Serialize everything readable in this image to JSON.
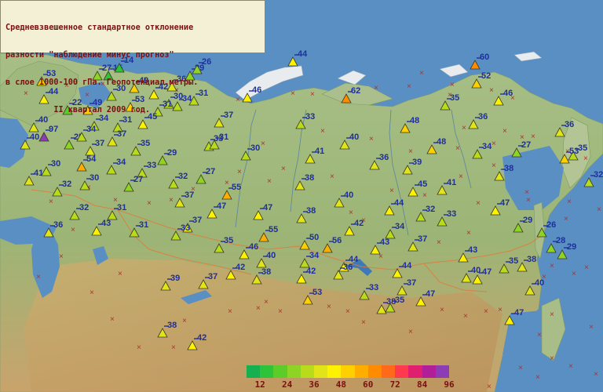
{
  "title": {
    "lines": [
      "Средневзвешенное стандартное отклонение",
      "разности \"наблюдение минус прогноз\"",
      "в слое 1000-100 гПа. Геопотенциал.метры.",
      "          II квартал 2009 год."
    ]
  },
  "legend": {
    "colors": [
      "#16b050",
      "#2ec43a",
      "#5ccc28",
      "#8ed424",
      "#b8dc1c",
      "#e0e418",
      "#fff200",
      "#ffd000",
      "#ffae00",
      "#ff8c00",
      "#ff6a1a",
      "#ff3a4e",
      "#e0206e",
      "#b01e9a",
      "#8c3cb4"
    ],
    "tick_labels": [
      "12",
      "24",
      "36",
      "48",
      "60",
      "72",
      "84",
      "96"
    ]
  },
  "stations": [
    {
      "value": "53"
    },
    {
      "value": "27"
    },
    {
      "value": "15"
    },
    {
      "value": "14"
    },
    {
      "value": "44"
    },
    {
      "value": "30"
    },
    {
      "value": "49"
    },
    {
      "value": "42"
    },
    {
      "value": "36"
    },
    {
      "value": "29"
    },
    {
      "value": "26"
    },
    {
      "value": "44"
    },
    {
      "value": "22"
    },
    {
      "value": "49"
    },
    {
      "value": "53"
    },
    {
      "value": "30"
    },
    {
      "value": "31"
    },
    {
      "value": "34"
    },
    {
      "value": "31"
    },
    {
      "value": "46"
    },
    {
      "value": "62"
    },
    {
      "value": "60"
    },
    {
      "value": "52"
    },
    {
      "value": "35"
    },
    {
      "value": "46"
    },
    {
      "value": "40"
    },
    {
      "value": "34"
    },
    {
      "value": "31"
    },
    {
      "value": "45"
    },
    {
      "value": "37"
    },
    {
      "value": "33"
    },
    {
      "value": "48"
    },
    {
      "value": "36"
    },
    {
      "value": "36"
    },
    {
      "value": "40"
    },
    {
      "value": "97"
    },
    {
      "value": "25"
    },
    {
      "value": "34"
    },
    {
      "value": "37"
    },
    {
      "value": "35"
    },
    {
      "value": "33"
    },
    {
      "value": "31"
    },
    {
      "value": "40"
    },
    {
      "value": "48"
    },
    {
      "value": "41"
    },
    {
      "value": "27"
    },
    {
      "value": "35"
    },
    {
      "value": "34"
    },
    {
      "value": "37"
    },
    {
      "value": "54"
    },
    {
      "value": "34"
    },
    {
      "value": "29"
    },
    {
      "value": "30"
    },
    {
      "value": "41"
    },
    {
      "value": "36"
    },
    {
      "value": "39"
    },
    {
      "value": "53"
    },
    {
      "value": "30"
    },
    {
      "value": "33"
    },
    {
      "value": "38"
    },
    {
      "value": "32"
    },
    {
      "value": "41"
    },
    {
      "value": "32"
    },
    {
      "value": "30"
    },
    {
      "value": "27"
    },
    {
      "value": "32"
    },
    {
      "value": "27"
    },
    {
      "value": "55"
    },
    {
      "value": "38"
    },
    {
      "value": "45"
    },
    {
      "value": "31"
    },
    {
      "value": "47"
    },
    {
      "value": "32"
    },
    {
      "value": "37"
    },
    {
      "value": "47"
    },
    {
      "value": "40"
    },
    {
      "value": "44"
    },
    {
      "value": "38"
    },
    {
      "value": "32"
    },
    {
      "value": "33"
    },
    {
      "value": "31"
    },
    {
      "value": "36"
    },
    {
      "value": "43"
    },
    {
      "value": "47"
    },
    {
      "value": "42"
    },
    {
      "value": "34"
    },
    {
      "value": "37"
    },
    {
      "value": "33"
    },
    {
      "value": "55"
    },
    {
      "value": "50"
    },
    {
      "value": "29"
    },
    {
      "value": "26"
    },
    {
      "value": "35"
    },
    {
      "value": "56"
    },
    {
      "value": "46"
    },
    {
      "value": "40"
    },
    {
      "value": "34"
    },
    {
      "value": "44"
    },
    {
      "value": "43"
    },
    {
      "value": "37"
    },
    {
      "value": "43"
    },
    {
      "value": "28"
    },
    {
      "value": "29"
    },
    {
      "value": "38"
    },
    {
      "value": "42"
    },
    {
      "value": "36"
    },
    {
      "value": "44"
    },
    {
      "value": "40"
    },
    {
      "value": "35"
    },
    {
      "value": "38"
    },
    {
      "value": "39"
    },
    {
      "value": "37"
    },
    {
      "value": "42"
    },
    {
      "value": "47"
    },
    {
      "value": "40"
    },
    {
      "value": "53"
    },
    {
      "value": "33"
    },
    {
      "value": "37"
    },
    {
      "value": "47"
    },
    {
      "value": "38"
    },
    {
      "value": "35"
    },
    {
      "value": "38"
    },
    {
      "value": "42"
    },
    {
      "value": "47"
    }
  ]
}
